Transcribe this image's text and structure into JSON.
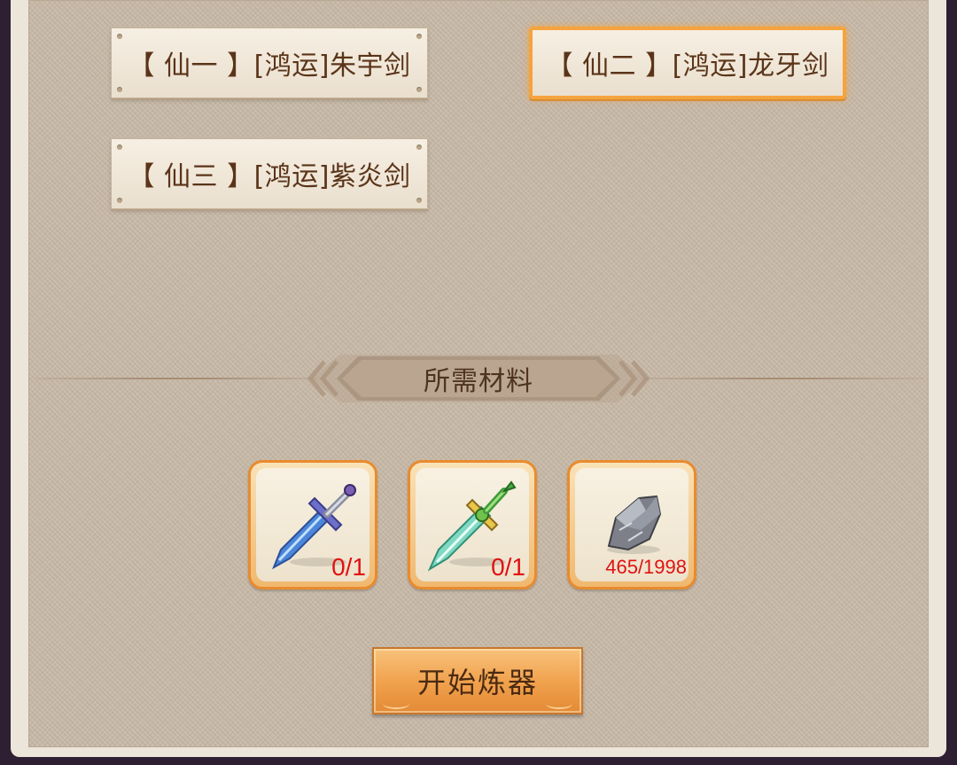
{
  "recipes": [
    {
      "label": "【 仙一 】[鸿运]朱宇剑",
      "selected": false
    },
    {
      "label": "【 仙二 】[鸿运]龙牙剑",
      "selected": true
    },
    {
      "label": "【 仙三 】[鸿运]紫炎剑",
      "selected": false
    }
  ],
  "materials": {
    "title": "所需材料",
    "items": [
      {
        "icon": "blue-sword-icon",
        "count": "0/1"
      },
      {
        "icon": "jade-sword-icon",
        "count": "0/1"
      },
      {
        "icon": "ore-stone-icon",
        "count": "465/1998"
      }
    ]
  },
  "actions": {
    "start_label": "开始炼器"
  },
  "colors": {
    "accent": "#f5a33d",
    "count_red": "#e01212",
    "text_brown": "#5a3419"
  }
}
